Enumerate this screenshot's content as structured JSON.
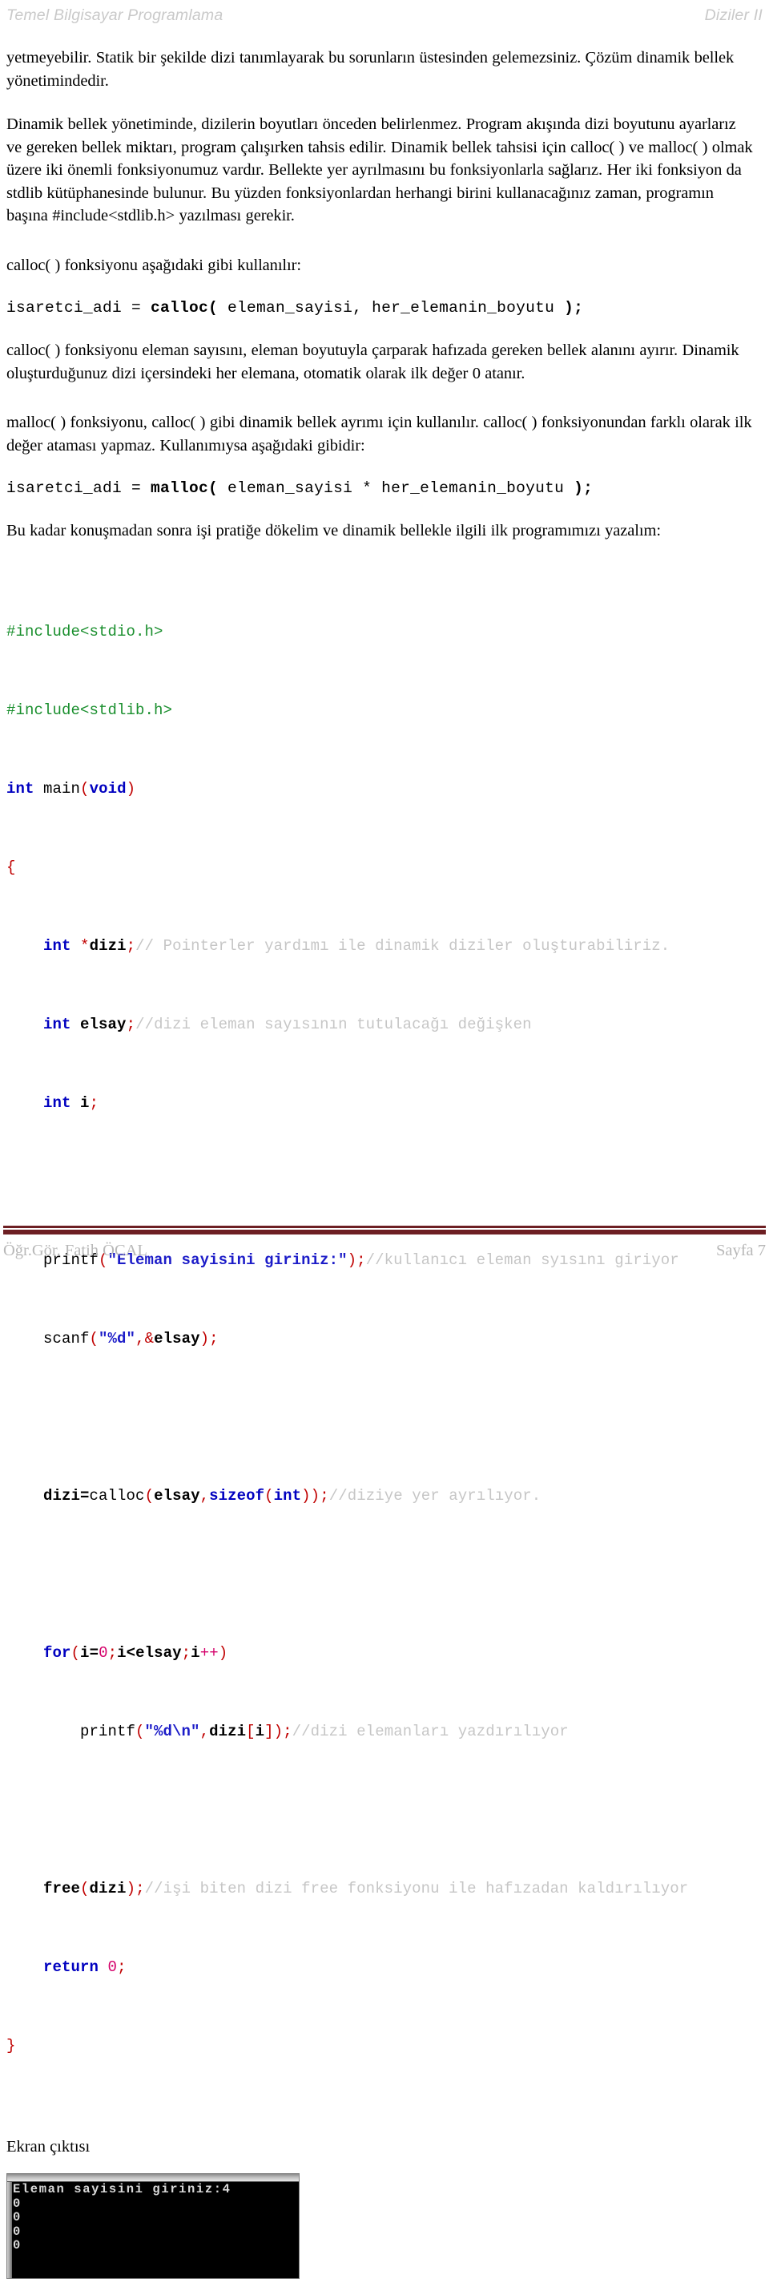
{
  "header": {
    "left": "Temel Bilgisayar Programlama",
    "right": "Diziler II"
  },
  "body": {
    "par1": "yetmeyebilir. Statik bir şekilde dizi tanımlayarak bu sorunların üstesinden gelemezsiniz. Çözüm dinamik bellek yönetimindedir.",
    "par2": "Dinamik bellek yönetiminde, dizilerin boyutları önceden belirlenmez. Program akışında dizi boyutunu ayarlarız ve gereken bellek miktarı, program çalışırken tahsis edilir. Dinamik bellek tahsisi için calloc( ) ve malloc( ) olmak üzere iki önemli fonksiyonumuz vardır. Bellekte yer ayrılmasını bu fonksiyonlarla sağlarız. Her iki fonksiyon da stdlib kütüphanesinde bulunur. Bu yüzden fonksiyonlardan herhangi birini kullanacağınız zaman, programın başına #include<stdlib.h> yazılması gerekir.",
    "par3": "calloc( ) fonksiyonu aşağıdaki gibi kullanılır:",
    "par4": "calloc( ) fonksiyonu eleman sayısını, eleman boyutuyla çarparak hafızada gereken bellek alanını ayırır. Dinamik oluşturduğunuz dizi içersindeki her elemana, otomatik olarak ilk değer 0 atanır.",
    "par5": "malloc( ) fonksiyonu, calloc( ) gibi dinamik bellek ayrımı için kullanılır. calloc( ) fonksiyonundan farklı olarak ilk değer ataması yapmaz. Kullanımıysa aşağıdaki gibidir:",
    "par6": "Bu kadar konuşmadan sonra işi pratiğe dökelim ve dinamik bellekle ilgili ilk programımızı yazalım:"
  },
  "calloc_signature": {
    "prefix": "isaretci_adi = ",
    "call": "calloc(",
    "args": " eleman_sayisi, her_elemanin_boyutu ",
    "suffix": ");"
  },
  "malloc_signature": {
    "prefix": "isaretci_adi = ",
    "call": "malloc(",
    "args": " eleman_sayisi * her_elemanin_boyutu ",
    "suffix": ");"
  },
  "source_code": {
    "line01": {
      "pp": "#include<stdio.h>"
    },
    "line02": {
      "pp": "#include<stdlib.h>"
    },
    "line03": {
      "kw": "int",
      "sp": " ",
      "fn": "main",
      "open": "(",
      "kw2": "void",
      "close": ")"
    },
    "line04": {
      "brace": "{"
    },
    "line05": {
      "indent": "    ",
      "kw": "int",
      "sp": " ",
      "star": "*",
      "id": "dizi",
      "semi": ";",
      "cmt": "// Pointerler yardımı ile dinamik diziler oluşturabiliriz."
    },
    "line06": {
      "indent": "    ",
      "kw": "int",
      "sp": " ",
      "id": "elsay",
      "semi": ";",
      "cmt": "//dizi eleman sayısının tutulacağı değişken"
    },
    "line07": {
      "indent": "    ",
      "kw": "int",
      "sp": " ",
      "id": "i",
      "semi": ";"
    },
    "line08": {
      "blank": ""
    },
    "line09": {
      "indent": "    ",
      "fn": "printf",
      "open": "(",
      "str": "\"Eleman sayisini giriniz:\"",
      "close": ")",
      "semi": ";",
      "cmt": "//kullanıcı eleman syısını giriyor"
    },
    "line10": {
      "indent": "    ",
      "fn": "scanf",
      "open": "(",
      "str": "\"%d\"",
      "comma": ",",
      "amp": "&",
      "id": "elsay",
      "close": ")",
      "semi": ";"
    },
    "line11": {
      "blank": ""
    },
    "line12": {
      "indent": "    ",
      "id": "dizi",
      "eq": "=",
      "fn": "calloc",
      "open": "(",
      "id2": "elsay",
      "comma": ",",
      "kw": "sizeof",
      "open2": "(",
      "kw2": "int",
      "close2": ")",
      "close": ")",
      "semi": ";",
      "cmt": "//diziye yer ayrılıyor."
    },
    "line13": {
      "blank": ""
    },
    "line14": {
      "indent": "    ",
      "kw": "for",
      "open": "(",
      "id": "i",
      "eq": "=",
      "num": "0",
      "semi1": ";",
      "id2": "i",
      "lt": "<",
      "id3": "elsay",
      "semi2": ";",
      "id4": "i",
      "inc": "++",
      "close": ")"
    },
    "line15": {
      "indent": "        ",
      "fn": "printf",
      "open": "(",
      "str": "\"%d\\n\"",
      "comma": ",",
      "id": "dizi",
      "lb": "[",
      "id2": "i",
      "rb": "]",
      "close": ")",
      "semi": ";",
      "cmt": "//dizi elemanları yazdırılıyor"
    },
    "line16": {
      "blank": ""
    },
    "line17": {
      "indent": "    ",
      "fn": "free",
      "open": "(",
      "id": "dizi",
      "close": ")",
      "semi": ";",
      "cmt": "//işi biten dizi free fonksiyonu ile hafızadan kaldırılıyor"
    },
    "line18": {
      "indent": "    ",
      "kw": "return",
      "sp": " ",
      "num": "0",
      "semi": ";"
    },
    "line19": {
      "brace": "}"
    }
  },
  "console": {
    "label": "Ekran çıktısı",
    "output": "Eleman sayisini giriniz:4\n0\n0\n0\n0"
  },
  "footer": {
    "left": "Öğr.Gör. Fatih ÖCAL",
    "right": "Sayfa 7"
  },
  "colors": {
    "keyword": "#0000c0",
    "preprocessor": "#1a8f2e",
    "string": "#1c1cc8",
    "punctuation": "#c00000",
    "number": "#d4006a",
    "comment": "#c6c6c6",
    "footer_rule": "#6d1f23",
    "header_text": "#c9c9c9"
  }
}
